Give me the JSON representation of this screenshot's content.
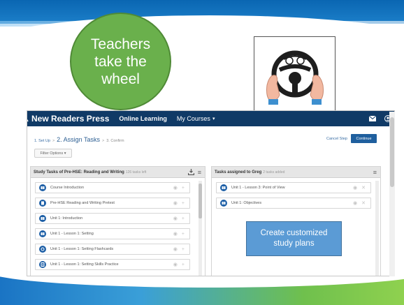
{
  "slide": {
    "bubble_text": "Teachers take the wheel",
    "callout_text": "Create customized study plans"
  },
  "navbar": {
    "brand": "New Readers Press",
    "online_learning": "Online Learning",
    "my_courses": "My Courses",
    "caret": "▾"
  },
  "steps": {
    "step1": "1. Set Up",
    "sep": ">",
    "step2": "2. Assign Tasks",
    "step3": "3. Confirm"
  },
  "actions": {
    "cancel": "Cancel Step",
    "continue": "Continue"
  },
  "filter": {
    "label": "Filter Options ▾"
  },
  "left_panel": {
    "title": "Study Tasks of Pre-HSE: Reading and Writing",
    "count": "126 tasks left",
    "tasks": [
      {
        "label": "Course Introduction"
      },
      {
        "label": "Pre-HSE Reading and Writing Pretest"
      },
      {
        "label": "Unit 1: Introduction"
      },
      {
        "label": "Unit 1 - Lesson 1: Setting"
      },
      {
        "label": "Unit 1 - Lesson 1: Setting Flashcards"
      },
      {
        "label": "Unit 1 - Lesson 1: Setting Skills Practice"
      }
    ]
  },
  "right_panel": {
    "title": "Tasks assigned to Greg",
    "count": "2 tasks added",
    "tasks": [
      {
        "label": "Unit 1 - Lesson 3: Point of View"
      },
      {
        "label": "Unit 1: Objectives"
      }
    ]
  },
  "colors": {
    "navbar": "#103a66",
    "bubble": "#6ab04c",
    "callout": "#5b9bd5",
    "task_icon": "#1d5fa6"
  }
}
